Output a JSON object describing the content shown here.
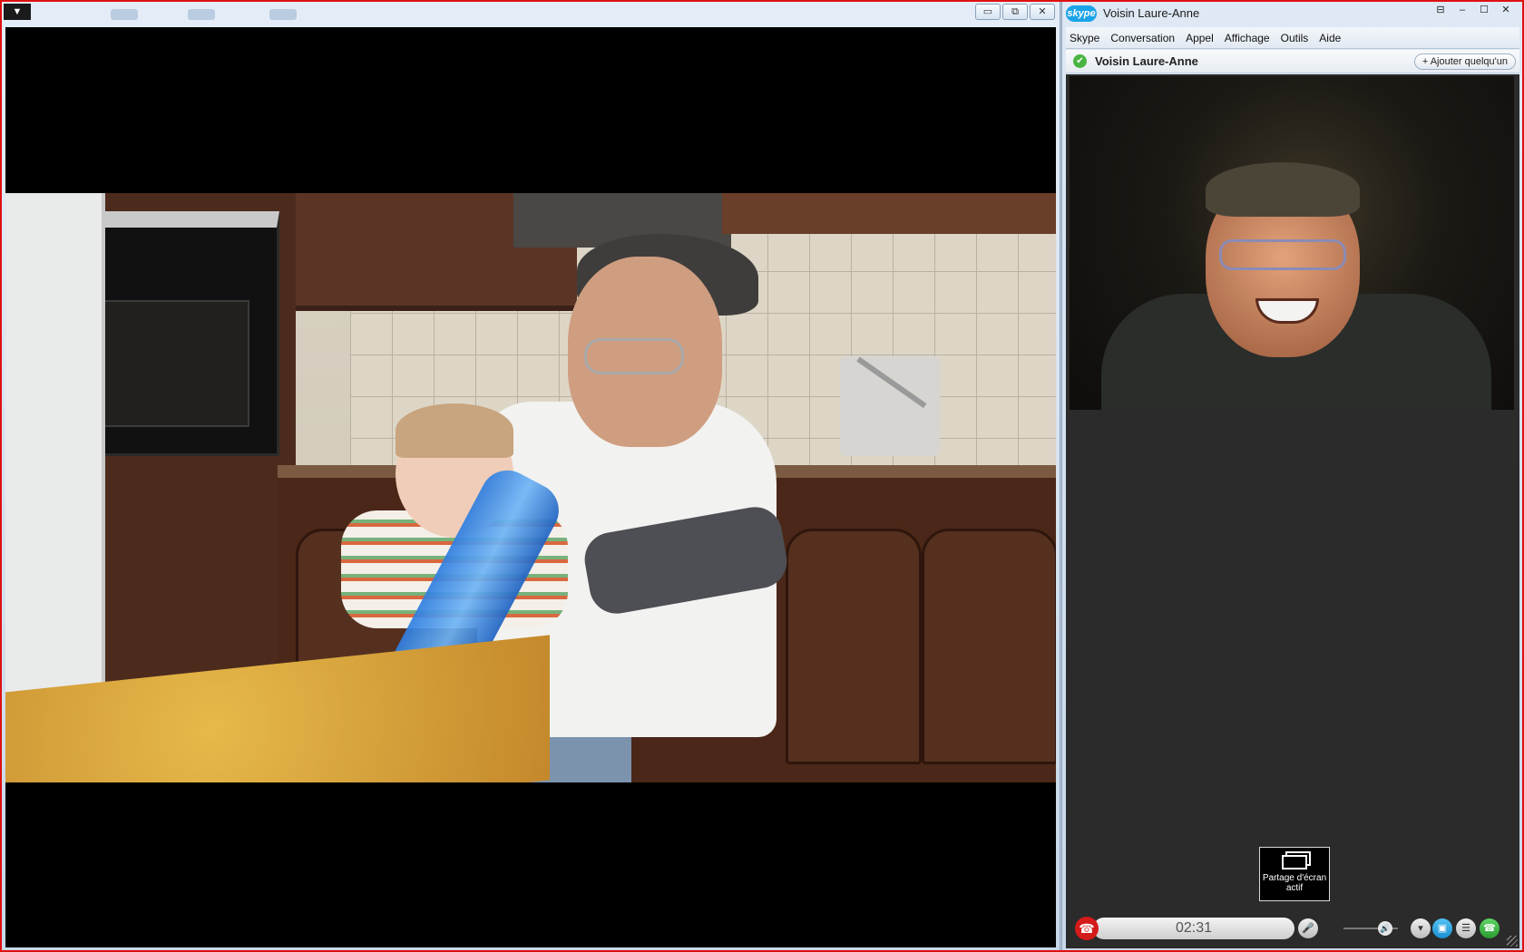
{
  "player": {
    "corner_arrow": "▼",
    "window_buttons": {
      "minimize": "▭",
      "restore": "⧉",
      "close": "✕"
    }
  },
  "skype": {
    "logo": "skype",
    "title": "Voisin Laure-Anne",
    "window_buttons": {
      "compact": "⊟",
      "minimize": "–",
      "maximize": "☐",
      "close": "✕"
    },
    "menu": [
      "Skype",
      "Conversation",
      "Appel",
      "Affichage",
      "Outils",
      "Aide"
    ],
    "contact": {
      "name": "Voisin Laure-Anne",
      "status_icon": "✔",
      "add_button": "+ Ajouter quelqu'un"
    },
    "share_tooltip": {
      "line1": "Partage d'écran",
      "line2": "actif"
    },
    "call": {
      "timer": "02:31",
      "hangup_icon": "☎",
      "mic_icon": "🎤",
      "volume_icon": "🔊",
      "more_icon": "▾",
      "video_icon": "▣",
      "chat_icon": "☰",
      "call_icon": "☎"
    },
    "colors": {
      "hangup": "#d51a1a",
      "accent": "#1aa3e8",
      "status_online": "#4bb543"
    }
  }
}
